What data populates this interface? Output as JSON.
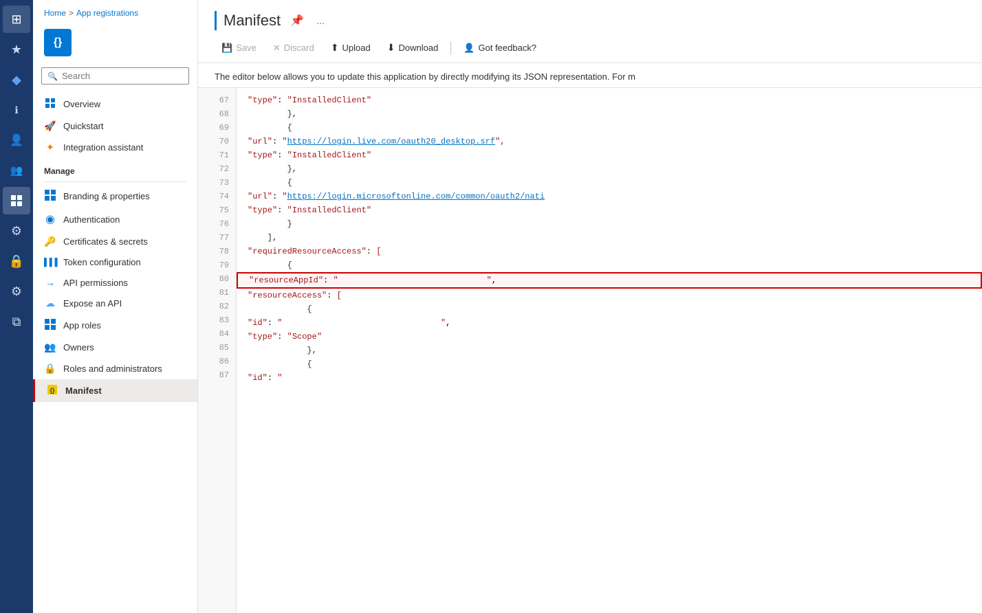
{
  "iconBar": {
    "items": [
      {
        "name": "home-icon",
        "icon": "⊞",
        "active": false
      },
      {
        "name": "favorites-icon",
        "icon": "★",
        "active": false
      },
      {
        "name": "diamond-icon",
        "icon": "◆",
        "active": false
      },
      {
        "name": "info-icon",
        "icon": "ℹ",
        "active": false
      },
      {
        "name": "user-icon",
        "icon": "👤",
        "active": false
      },
      {
        "name": "users-icon",
        "icon": "👥",
        "active": false
      },
      {
        "name": "grid-icon",
        "icon": "⊞",
        "active": true
      },
      {
        "name": "gear-icon",
        "icon": "⚙",
        "active": false
      },
      {
        "name": "lock-icon",
        "icon": "🔒",
        "active": false
      },
      {
        "name": "settings2-icon",
        "icon": "⚙",
        "active": false
      },
      {
        "name": "layers-icon",
        "icon": "⧉",
        "active": false
      }
    ]
  },
  "breadcrumb": {
    "home": "Home",
    "separator": ">",
    "current": "App registrations"
  },
  "appIcon": {
    "symbol": "{}"
  },
  "search": {
    "placeholder": "Search"
  },
  "nav": {
    "overview": "Overview",
    "quickstart": "Quickstart",
    "integration": "Integration assistant",
    "manageLabel": "Manage",
    "items": [
      {
        "name": "branding-properties",
        "label": "Branding & properties",
        "icon": "▦"
      },
      {
        "name": "authentication",
        "label": "Authentication",
        "icon": "◉"
      },
      {
        "name": "certificates-secrets",
        "label": "Certificates & secrets",
        "icon": "🗝"
      },
      {
        "name": "token-configuration",
        "label": "Token configuration",
        "icon": "▐▐▐"
      },
      {
        "name": "api-permissions",
        "label": "API permissions",
        "icon": "→"
      },
      {
        "name": "expose-an-api",
        "label": "Expose an API",
        "icon": "☁"
      },
      {
        "name": "app-roles",
        "label": "App roles",
        "icon": "▦"
      },
      {
        "name": "owners",
        "label": "Owners",
        "icon": "👥"
      },
      {
        "name": "roles-administrators",
        "label": "Roles and administrators",
        "icon": "🔒"
      },
      {
        "name": "manifest",
        "label": "Manifest",
        "icon": "⊟",
        "active": true
      }
    ]
  },
  "header": {
    "title": "Manifest",
    "pinIcon": "📌",
    "moreIcon": "..."
  },
  "toolbar": {
    "save": "Save",
    "discard": "Discard",
    "upload": "Upload",
    "download": "Download",
    "feedback": "Got feedback?"
  },
  "description": "The editor below allows you to update this application by directly modifying its JSON representation. For m",
  "codeLines": [
    {
      "num": 67,
      "content": "            \"type\": \"InstalledClient\"",
      "type": "normal"
    },
    {
      "num": 68,
      "content": "        },",
      "type": "normal"
    },
    {
      "num": 69,
      "content": "        {",
      "type": "normal"
    },
    {
      "num": 70,
      "content": "            \"url\": \"https://login.live.com/oauth20_desktop.srf\",",
      "type": "url"
    },
    {
      "num": 71,
      "content": "            \"type\": \"InstalledClient\"",
      "type": "normal"
    },
    {
      "num": 72,
      "content": "        },",
      "type": "normal"
    },
    {
      "num": 73,
      "content": "        {",
      "type": "normal"
    },
    {
      "num": 74,
      "content": "            \"url\": \"https://login.microsoftonline.com/common/oauth2/nati",
      "type": "url"
    },
    {
      "num": 75,
      "content": "            \"type\": \"InstalledClient\"",
      "type": "normal"
    },
    {
      "num": 76,
      "content": "        }",
      "type": "normal"
    },
    {
      "num": 77,
      "content": "    ],",
      "type": "normal"
    },
    {
      "num": 78,
      "content": "    \"requiredResourceAccess\": [",
      "type": "normal"
    },
    {
      "num": 79,
      "content": "        {",
      "type": "normal"
    },
    {
      "num": 80,
      "content": "            \"resourceAppId\": \"                              \",",
      "type": "highlighted"
    },
    {
      "num": 81,
      "content": "            \"resourceAccess\": [",
      "type": "normal"
    },
    {
      "num": 82,
      "content": "            {",
      "type": "normal"
    },
    {
      "num": 83,
      "content": "                    \"id\": \"                                \",",
      "type": "normal"
    },
    {
      "num": 84,
      "content": "                    \"type\": \"Scope\"",
      "type": "normal"
    },
    {
      "num": 85,
      "content": "            },",
      "type": "normal"
    },
    {
      "num": 86,
      "content": "            {",
      "type": "normal"
    },
    {
      "num": 87,
      "content": "                    \"id\": \"",
      "type": "normal"
    }
  ]
}
